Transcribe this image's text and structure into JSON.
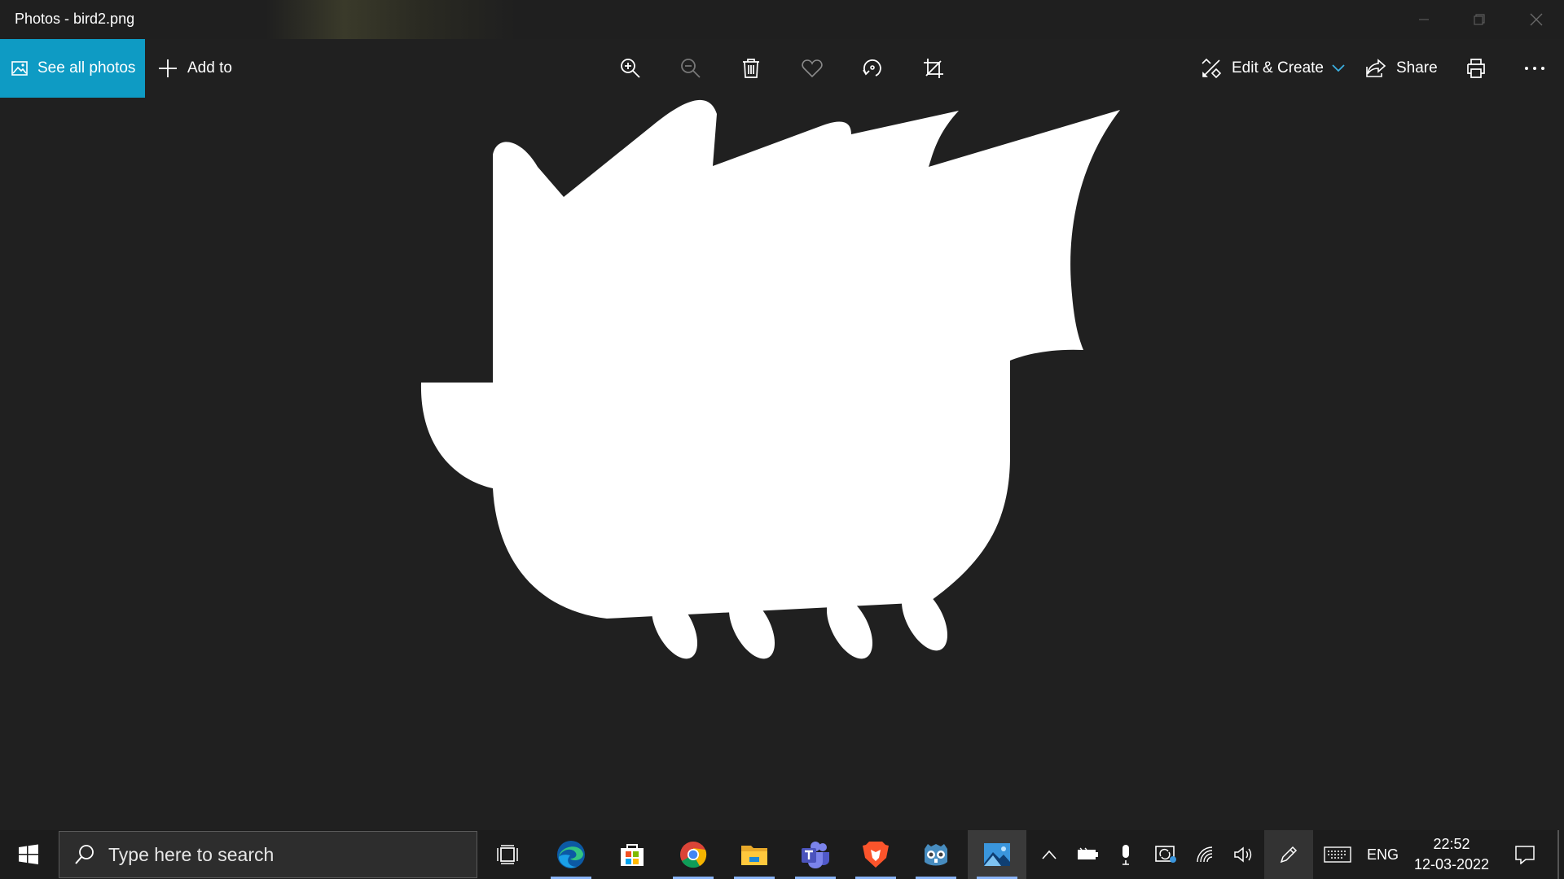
{
  "window": {
    "title": "Photos - bird2.png"
  },
  "toolbar": {
    "see_all_label": "See all photos",
    "add_to_label": "Add to",
    "edit_create_label": "Edit & Create",
    "share_label": "Share",
    "accent_color": "#0e9bc4"
  },
  "image": {
    "file": "bird2.png",
    "background": "#202020",
    "shape_color": "#ffffff"
  },
  "taskbar": {
    "search_placeholder": "Type here to search",
    "apps": [
      "Task View",
      "Microsoft Edge",
      "Microsoft Store",
      "Google Chrome",
      "File Explorer",
      "Microsoft Teams",
      "Brave",
      "Godot",
      "Photos"
    ],
    "language": "ENG",
    "time": "22:52",
    "date": "12-03-2022"
  }
}
